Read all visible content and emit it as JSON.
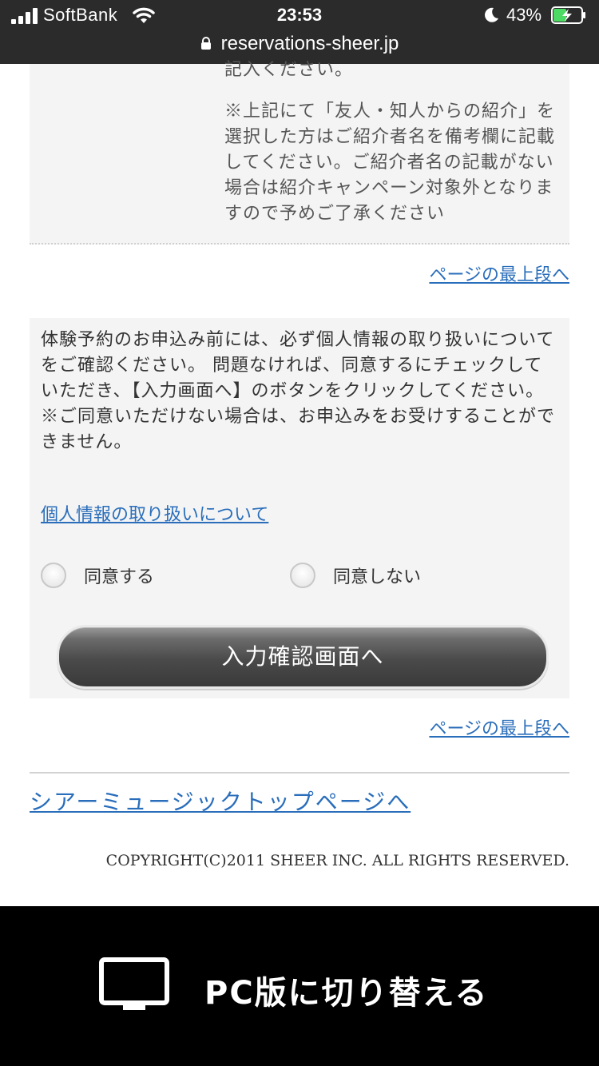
{
  "status_bar": {
    "carrier": "SoftBank",
    "time": "23:53",
    "battery_percent": "43%"
  },
  "browser": {
    "url": "reservations-sheer.jp"
  },
  "note": {
    "partial_line": "記入ください。",
    "paragraph": "※上記にて「友人・知人からの紹介」を選択した方はご紹介者名を備考欄に記載してください。ご紹介者名の記載がない場合は紹介キャンペーン対象外となりますので予めご了承ください"
  },
  "links": {
    "page_top_1": "ページの最上段へ",
    "page_top_2": "ページの最上段へ",
    "privacy": "個人情報の取り扱いについて",
    "sheer_top": "シアーミュージックトップページへ"
  },
  "consent": {
    "text_1": "体験予約のお申込み前には、必ず個人情報の取り扱いについてをご確認ください。 問題なければ、同意するにチェックしていただき、【入力画面へ】のボタンをクリックしてください。",
    "text_2": "※ご同意いただけない場合は、お申込みをお受けすることができません。",
    "agree_label": "同意する",
    "disagree_label": "同意しない",
    "submit_label": "入力確認画面へ"
  },
  "footer": {
    "copyright": "COPYRIGHT(C)2011 SHEER INC. ALL RIGHTS RESERVED."
  },
  "pc_switch": {
    "label": "PC版に切り替える"
  }
}
